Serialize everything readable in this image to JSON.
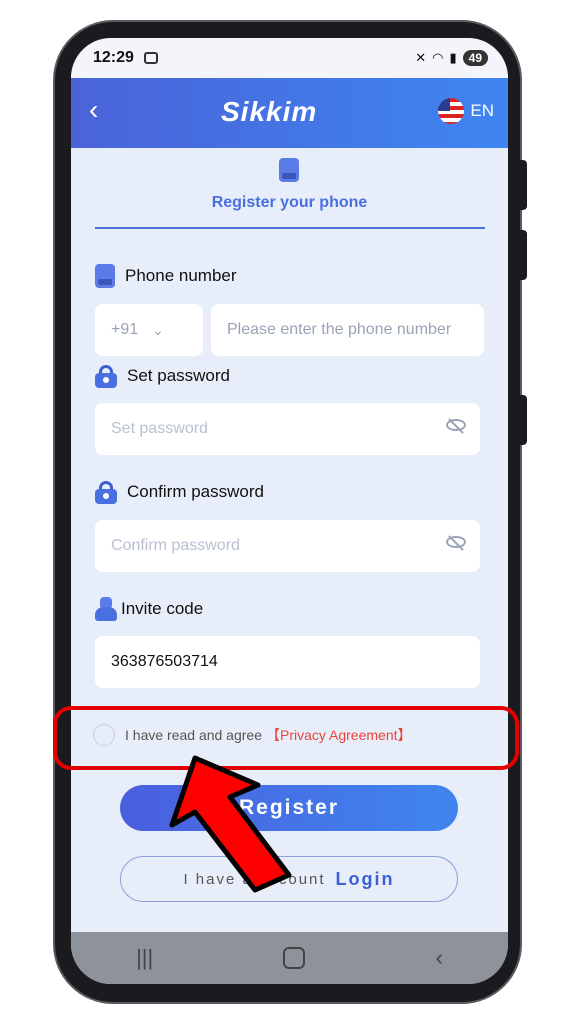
{
  "status": {
    "time": "12:29",
    "battery": "49"
  },
  "header": {
    "back": "‹",
    "brand": "Sikkim",
    "lang": "EN"
  },
  "tab": {
    "label": "Register your phone"
  },
  "phone": {
    "label": "Phone number",
    "code": "+91",
    "placeholder": "Please enter the phone number"
  },
  "password": {
    "label": "Set password",
    "placeholder": "Set password"
  },
  "confirm": {
    "label": "Confirm password",
    "placeholder": "Confirm password"
  },
  "invite": {
    "label": "Invite code",
    "value": "363876503714"
  },
  "agree": {
    "text": "I have read and agree",
    "link": "【Privacy Agreement】"
  },
  "buttons": {
    "register": "Register",
    "has_account": "I have a account",
    "login": "Login"
  },
  "colors": {
    "accent": "#4a6fe0",
    "highlight": "#e40000"
  }
}
